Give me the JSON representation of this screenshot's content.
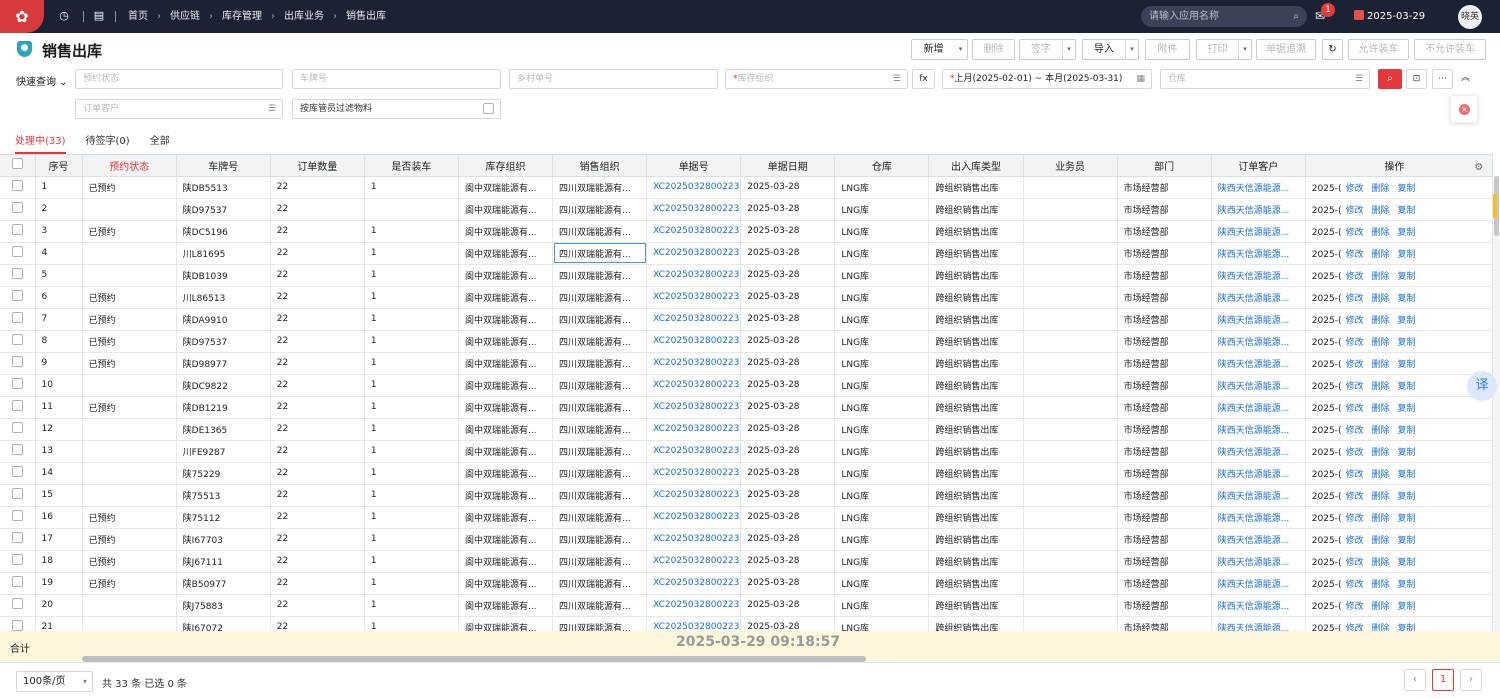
{
  "topbar": {
    "breadcrumbs": [
      "首页",
      "供应链",
      "库存管理",
      "出库业务",
      "销售出库"
    ],
    "search_placeholder": "请输入应用名称",
    "notification_count": "1",
    "date": "2025-03-29",
    "user": "晓英"
  },
  "page": {
    "title": "销售出库",
    "toolbar": {
      "add": "新增",
      "delete": "删除",
      "sign": "签字",
      "import": "导入",
      "attach": "附件",
      "print": "打印",
      "trace": "单据追溯",
      "allow_load": "允许装车",
      "disallow_load": "不允许装车"
    }
  },
  "filters": {
    "quick_query": "快速查询",
    "booking_status": "预约状态",
    "plate_no": "车牌号",
    "village_order": "乡村单号",
    "stock_org": "库存组织",
    "fx": "fx",
    "date_range": "上月(2025-02-01)  ~ 本月(2025-03-31)",
    "warehouse": "仓库",
    "order_customer": "订单客户",
    "filter_by_keeper": "按库管员过滤物料"
  },
  "tabs": [
    "处理中(33)",
    "待签字(0)",
    "全部"
  ],
  "table": {
    "headers": [
      "序号",
      "预约状态",
      "车牌号",
      "订单数量",
      "是否装车",
      "库存组织",
      "销售组织",
      "单据号",
      "单据日期",
      "仓库",
      "出入库类型",
      "业务员",
      "部门",
      "订单客户",
      "操作"
    ],
    "rows": [
      {
        "n": "1",
        "status": "已预约",
        "plate": "陕DB5513",
        "qty": "22",
        "loaded": "1"
      },
      {
        "n": "2",
        "status": "",
        "plate": "陕D97537",
        "qty": "22",
        "loaded": ""
      },
      {
        "n": "3",
        "status": "已预约",
        "plate": "陕DC5196",
        "qty": "22",
        "loaded": "1"
      },
      {
        "n": "4",
        "status": "",
        "plate": "川L81695",
        "qty": "22",
        "loaded": "1"
      },
      {
        "n": "5",
        "status": "",
        "plate": "陕DB1039",
        "qty": "22",
        "loaded": "1"
      },
      {
        "n": "6",
        "status": "已预约",
        "plate": "川L86513",
        "qty": "22",
        "loaded": "1"
      },
      {
        "n": "7",
        "status": "已预约",
        "plate": "陕DA9910",
        "qty": "22",
        "loaded": "1"
      },
      {
        "n": "8",
        "status": "已预约",
        "plate": "陕D97537",
        "qty": "22",
        "loaded": "1"
      },
      {
        "n": "9",
        "status": "已预约",
        "plate": "陕D98977",
        "qty": "22",
        "loaded": "1"
      },
      {
        "n": "10",
        "status": "",
        "plate": "陕DC9822",
        "qty": "22",
        "loaded": "1"
      },
      {
        "n": "11",
        "status": "已预约",
        "plate": "陕DB1219",
        "qty": "22",
        "loaded": "1"
      },
      {
        "n": "12",
        "status": "",
        "plate": "陕DE1365",
        "qty": "22",
        "loaded": "1"
      },
      {
        "n": "13",
        "status": "",
        "plate": "川FE9287",
        "qty": "22",
        "loaded": "1"
      },
      {
        "n": "14",
        "status": "",
        "plate": "陕75229",
        "qty": "22",
        "loaded": "1"
      },
      {
        "n": "15",
        "status": "",
        "plate": "陕75513",
        "qty": "22",
        "loaded": "1"
      },
      {
        "n": "16",
        "status": "已预约",
        "plate": "陕75112",
        "qty": "22",
        "loaded": "1"
      },
      {
        "n": "17",
        "status": "已预约",
        "plate": "陕I67703",
        "qty": "22",
        "loaded": "1"
      },
      {
        "n": "18",
        "status": "已预约",
        "plate": "陕J67111",
        "qty": "22",
        "loaded": "1"
      },
      {
        "n": "19",
        "status": "已预约",
        "plate": "陕B50977",
        "qty": "22",
        "loaded": "1"
      },
      {
        "n": "20",
        "status": "",
        "plate": "陕J75883",
        "qty": "22",
        "loaded": "1"
      },
      {
        "n": "21",
        "status": "",
        "plate": "陕J67072",
        "qty": "22",
        "loaded": "1"
      }
    ],
    "common": {
      "stock_org": "阆中双瑞能源有...",
      "sales_org": "四川双瑞能源有...",
      "doc_no": "XC2025032800223...",
      "doc_date": "2025-03-28",
      "warehouse": "LNG库",
      "io_type": "跨组织销售出库",
      "dept": "市场经营部",
      "customer": "陕西天信源能源...",
      "op_prefix": "2025-(",
      "op_edit": "修改",
      "op_delete": "删除",
      "op_copy": "复制"
    }
  },
  "total": {
    "label": "合计",
    "timestamp": "2025-03-29 09:18:57"
  },
  "footer": {
    "page_size": "100条/页",
    "summary": "共 33 条 已选 0 条",
    "page": "1",
    "prev": "‹",
    "next": "›"
  }
}
